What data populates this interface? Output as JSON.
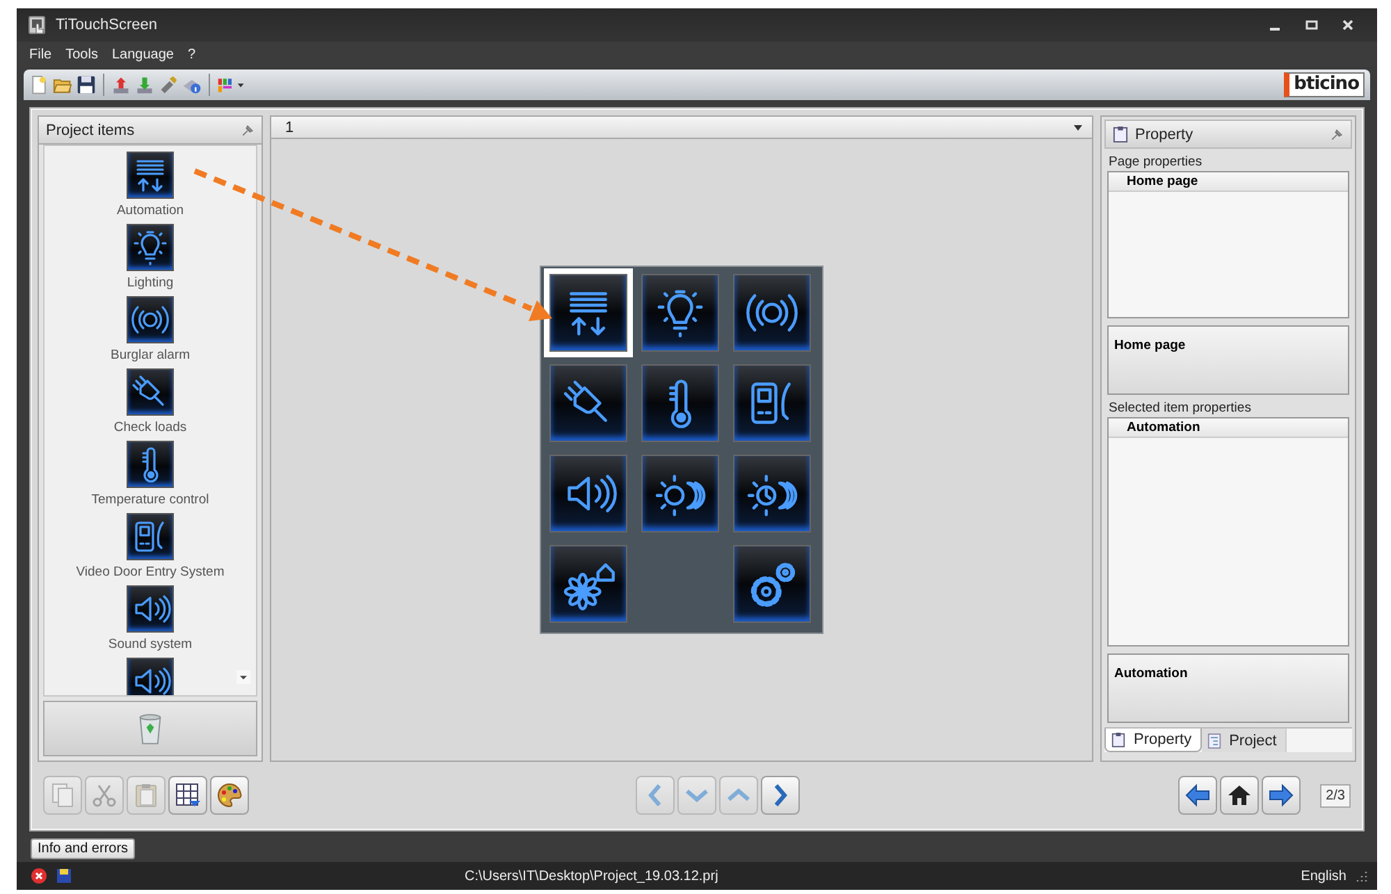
{
  "window": {
    "title": "TiTouchScreen"
  },
  "menu": [
    "File",
    "Tools",
    "Language",
    "?"
  ],
  "logo": "bticino",
  "project_items": {
    "title": "Project items",
    "items": [
      {
        "kind": "automation",
        "label": "Automation"
      },
      {
        "kind": "lighting",
        "label": "Lighting"
      },
      {
        "kind": "alarm",
        "label": "Burglar alarm"
      },
      {
        "kind": "loads",
        "label": "Check loads"
      },
      {
        "kind": "temperature",
        "label": "Temperature control"
      },
      {
        "kind": "video",
        "label": "Video Door Entry System"
      },
      {
        "kind": "sound",
        "label": "Sound system"
      },
      {
        "kind": "sound"
      }
    ]
  },
  "page_selector": {
    "value": "1"
  },
  "panel_grid": {
    "tiles": [
      {
        "kind": "automation",
        "selected": true
      },
      {
        "kind": "lighting",
        "selected": false
      },
      {
        "kind": "alarm",
        "selected": false
      },
      {
        "kind": "loads",
        "selected": false
      },
      {
        "kind": "temperature",
        "selected": false
      },
      {
        "kind": "video",
        "selected": false
      },
      {
        "kind": "sound",
        "selected": false
      },
      {
        "kind": "scenario",
        "selected": false
      },
      {
        "kind": "scheduled",
        "selected": false
      },
      {
        "kind": "flower",
        "selected": false
      },
      {
        "kind": "empty"
      },
      {
        "kind": "gears",
        "selected": false
      }
    ]
  },
  "property": {
    "title": "Property",
    "page_label": "Page properties",
    "page_header": "Home page",
    "page_description": "Home page",
    "item_label": "Selected item properties",
    "item_header": "Automation",
    "item_description": "Automation",
    "tabs": [
      {
        "label": "Property",
        "selected": true
      },
      {
        "label": "Project",
        "selected": false
      }
    ]
  },
  "edit_buttons": [
    {
      "kind": "copy",
      "disabled": true
    },
    {
      "kind": "cut",
      "disabled": true
    },
    {
      "kind": "paste",
      "disabled": true
    },
    {
      "kind": "table",
      "disabled": false
    },
    {
      "kind": "palette",
      "disabled": false
    }
  ],
  "nav_buttons": [
    {
      "kind": "left",
      "disabled": true
    },
    {
      "kind": "down",
      "disabled": true
    },
    {
      "kind": "up",
      "disabled": true
    },
    {
      "kind": "right",
      "disabled": false
    }
  ],
  "page_counter": "2/3",
  "info_button": "Info and errors",
  "status_bar": {
    "path": "C:\\Users\\IT\\Desktop\\Project_19.03.12.prj",
    "language": "English"
  }
}
